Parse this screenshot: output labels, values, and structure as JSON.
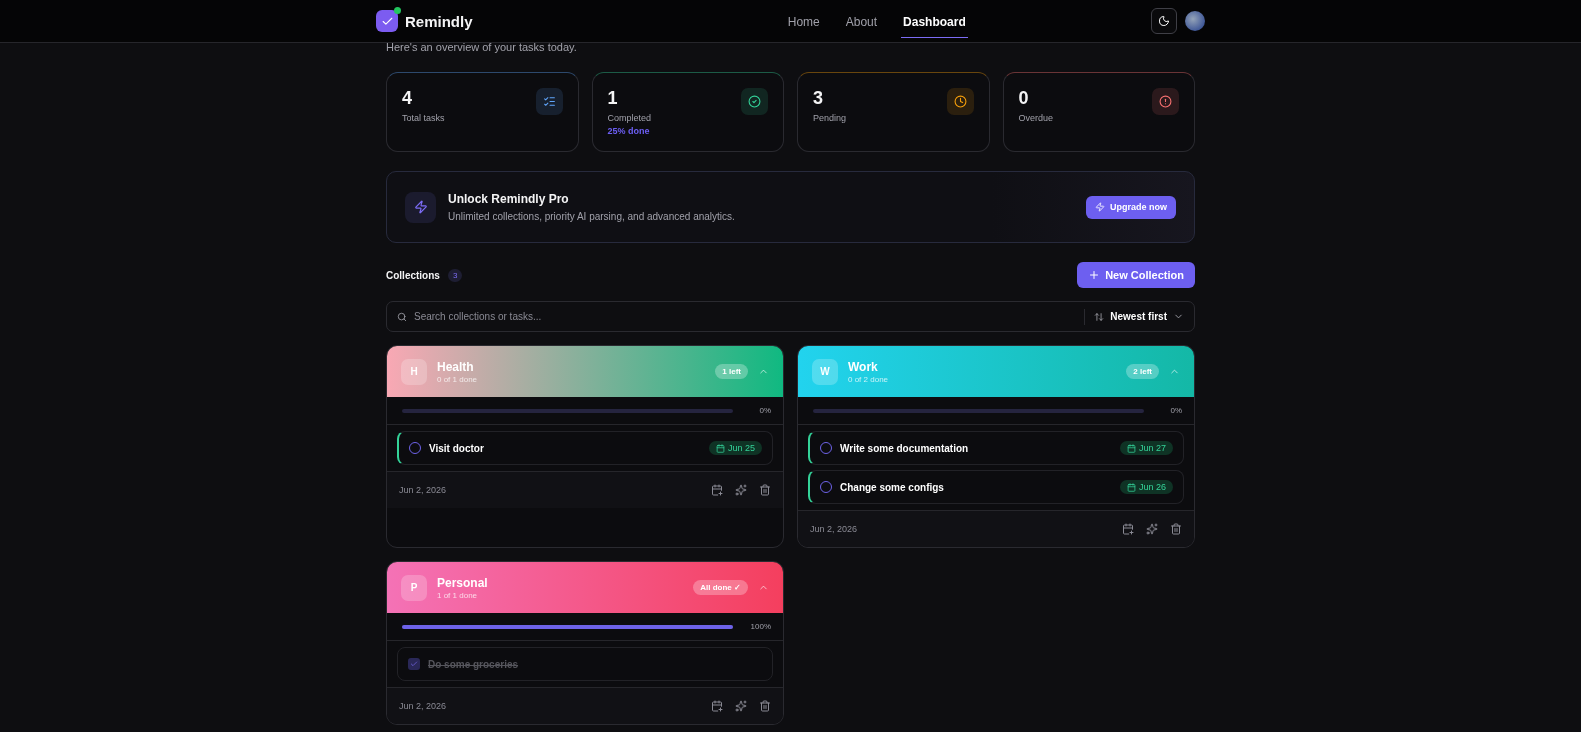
{
  "header": {
    "brand": "Remindly",
    "nav": [
      {
        "label": "Home",
        "selected": false
      },
      {
        "label": "About",
        "selected": false
      },
      {
        "label": "Dashboard",
        "selected": true
      }
    ]
  },
  "subtitle": "Here's an overview of your tasks today.",
  "stats": [
    {
      "kind": "total",
      "value": "4",
      "label": "Total tasks",
      "color": "#60a5fa"
    },
    {
      "kind": "completed",
      "value": "1",
      "label": "Completed",
      "note": "25% done",
      "color": "#34d399"
    },
    {
      "kind": "pending",
      "value": "3",
      "label": "Pending",
      "color": "#f59e0b"
    },
    {
      "kind": "overdue",
      "value": "0",
      "label": "Overdue",
      "color": "#f87171"
    }
  ],
  "promo": {
    "title": "Unlock Remindly Pro",
    "text": "Unlimited collections, priority AI parsing, and advanced analytics.",
    "button": "Upgrade now"
  },
  "collections_header": {
    "title": "Collections",
    "count": "3",
    "button": "New Collection"
  },
  "search": {
    "placeholder": "Search collections or tasks...",
    "sort": "Newest first"
  },
  "collections": [
    {
      "initial": "H",
      "name": "Health",
      "progress_text": "0 of 1 done",
      "badge": "1 left",
      "color": "#f9a8b4",
      "level": 0,
      "percent": "0%",
      "created": "Jun 2, 2026",
      "tasks": [
        {
          "title": "Visit doctor",
          "due": "Jun 25",
          "done": false
        }
      ]
    },
    {
      "initial": "W",
      "name": "Work",
      "progress_text": "0 of 2 done",
      "badge": "2 left",
      "color": "#22d3ee",
      "level": 0,
      "percent": "0%",
      "created": "Jun 2, 2026",
      "tasks": [
        {
          "title": "Write some documentation",
          "due": "Jun 27",
          "done": false
        },
        {
          "title": "Change some configs",
          "due": "Jun 26",
          "done": false
        }
      ]
    },
    {
      "initial": "P",
      "name": "Personal",
      "progress_text": "1 of 1 done",
      "badge": "All done ✓",
      "color": "#f472b6",
      "level": 1,
      "percent": "100%",
      "created": "Jun 2, 2026",
      "tasks": [
        {
          "title": "Do some groceries",
          "done": true
        }
      ]
    }
  ]
}
